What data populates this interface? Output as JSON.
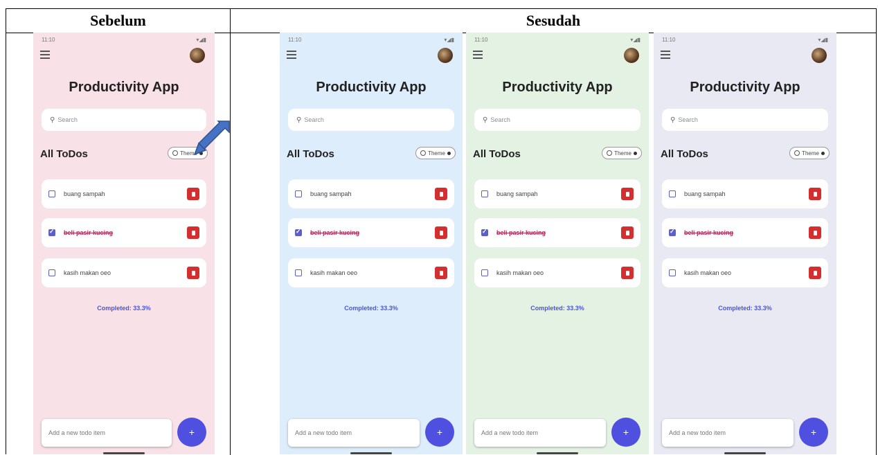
{
  "headers": {
    "before": "Sebelum",
    "after": "Sesudah"
  },
  "app": {
    "status_time": "11:10",
    "status_icons": "▾◢▮",
    "title": "Productivity App",
    "search_placeholder": "Search",
    "section_title": "All ToDos",
    "theme_label": "Theme",
    "todos": [
      {
        "text": "buang sampah",
        "checked": false
      },
      {
        "text": "beli pasir kucing",
        "checked": true
      },
      {
        "text": "kasih makan oeo",
        "checked": false
      }
    ],
    "completed_text": "Completed: 33.3%",
    "add_placeholder": "Add a new todo item",
    "fab_icon": "+"
  },
  "icons": {
    "menu": "hamburger-menu-icon",
    "search": "search-icon",
    "theme": "palette-icon",
    "delete": "trash-icon",
    "avatar": "user-avatar"
  },
  "themes": [
    {
      "name": "pink",
      "bg": "#f9e1e8"
    },
    {
      "name": "blue",
      "bg": "#deedfb"
    },
    {
      "name": "green",
      "bg": "#e4f2e4"
    },
    {
      "name": "lavender",
      "bg": "#e8e9f3"
    }
  ],
  "accent": "#4f4fe0",
  "delete_color": "#d32f2f"
}
